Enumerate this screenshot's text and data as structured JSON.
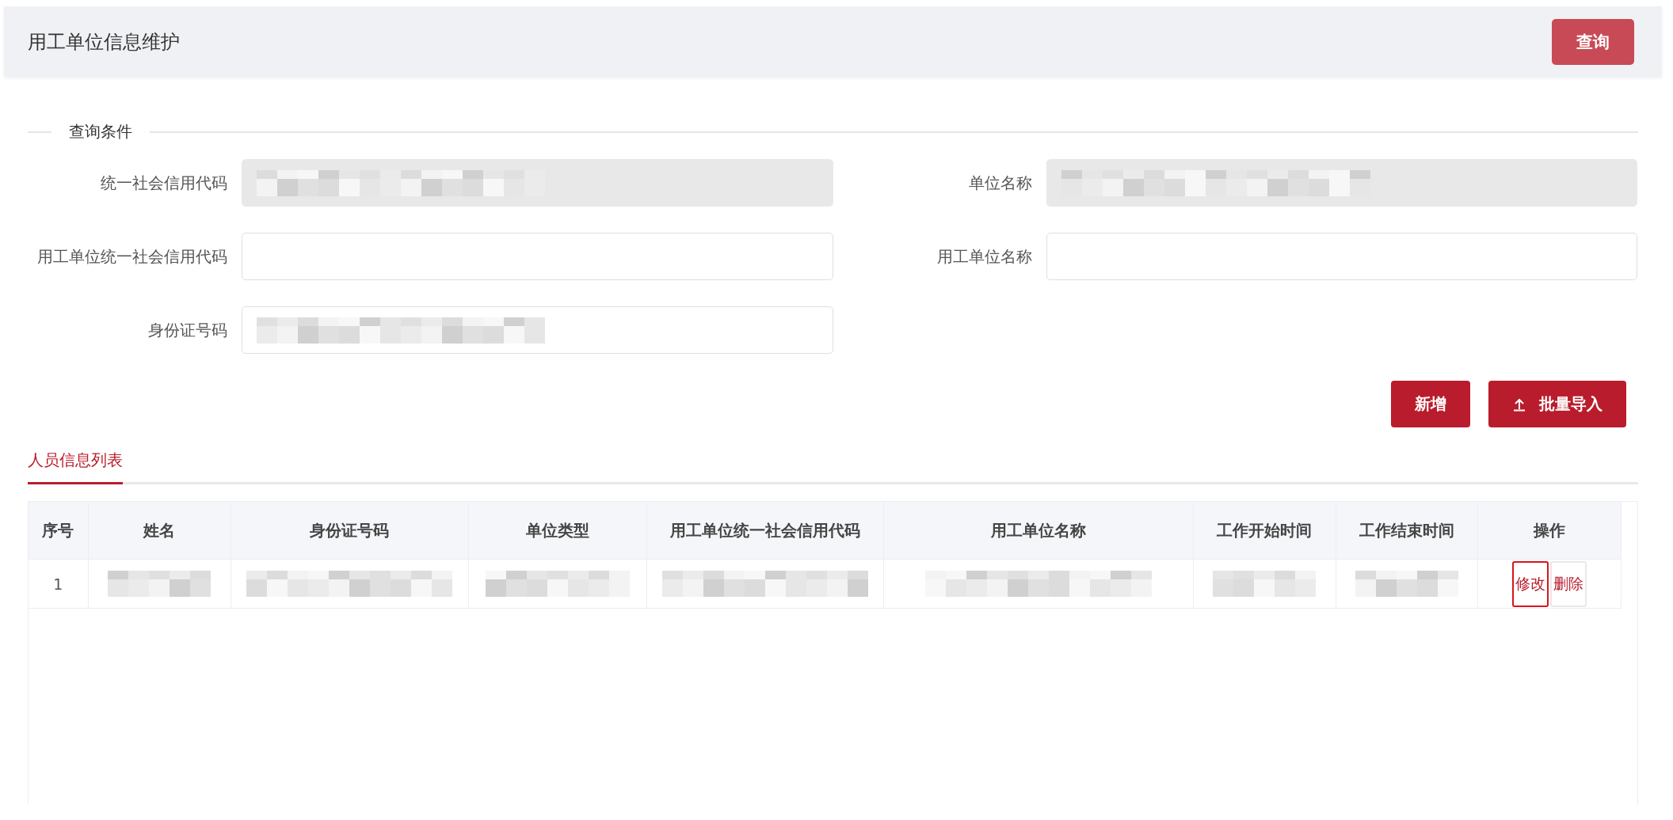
{
  "header": {
    "title": "用工单位信息维护",
    "query_button": "查询"
  },
  "section_title": "查询条件",
  "fields": [
    {
      "label": "统一社会信用代码",
      "disabled": true,
      "redacted": true
    },
    {
      "label": "单位名称",
      "disabled": true,
      "redacted": true
    },
    {
      "label": "用工单位统一社会信用代码",
      "disabled": false,
      "redacted": false
    },
    {
      "label": "用工单位名称",
      "disabled": false,
      "redacted": false
    },
    {
      "label": "身份证号码",
      "disabled": false,
      "redacted": true
    }
  ],
  "actions": [
    {
      "label": "新增",
      "kind": "plain"
    },
    {
      "label": "批量导入",
      "kind": "upload"
    }
  ],
  "tabs": [
    {
      "label": "人员信息列表",
      "selected": true
    }
  ],
  "table": {
    "columns": [
      "序号",
      "姓名",
      "身份证号码",
      "单位类型",
      "用工单位统一社会信用代码",
      "用工单位名称",
      "工作开始时间",
      "工作结束时间",
      "操作"
    ],
    "rows": [
      {
        "cells": [
          {
            "text": "1"
          },
          {
            "redacted": true
          },
          {
            "redacted": true
          },
          {
            "redacted": true
          },
          {
            "redacted": true
          },
          {
            "redacted": true
          },
          {
            "redacted": true
          },
          {
            "redacted": true
          }
        ],
        "actions": [
          {
            "label": "修改",
            "focused": true
          },
          {
            "label": "删除",
            "focused": false
          }
        ]
      }
    ]
  }
}
